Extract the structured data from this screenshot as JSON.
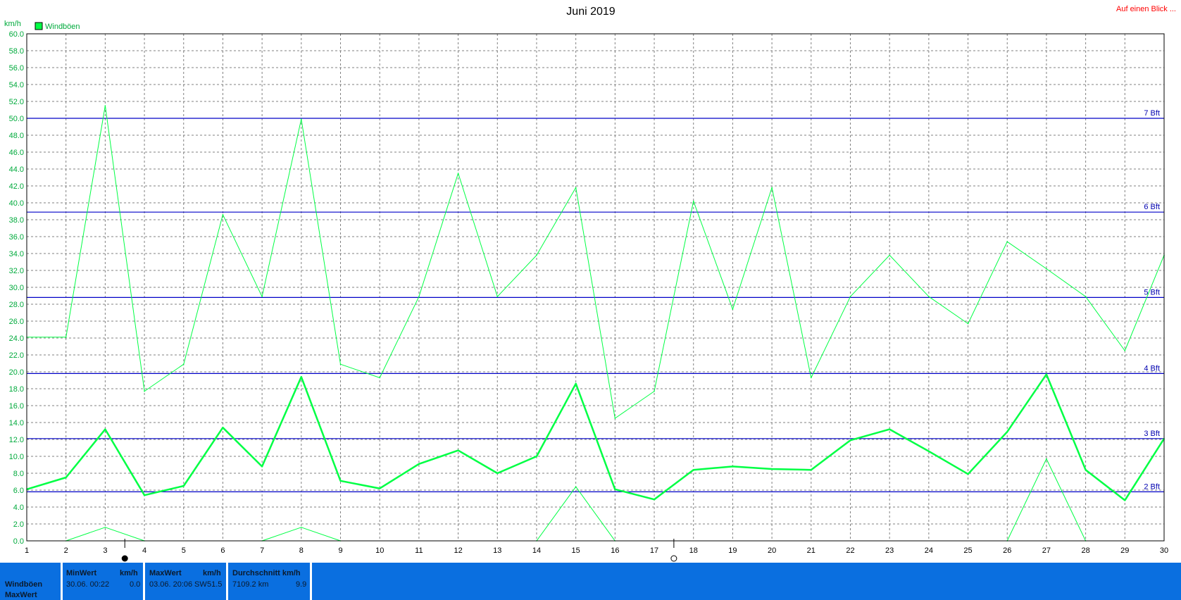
{
  "header": {
    "title": "Juni 2019",
    "link": "Auf einen Blick ...",
    "unit": "km/h",
    "legend": "Windböen"
  },
  "colors": {
    "series": "#00ff44",
    "grid": "#808080",
    "bft": "#0000c8",
    "link": "#ff0000",
    "stats_bg": "#0a6fe0"
  },
  "chart_data": {
    "type": "line",
    "title": "Juni 2019",
    "xlabel": "",
    "ylabel": "km/h",
    "xlim": [
      1,
      30
    ],
    "ylim": [
      0,
      60
    ],
    "x": [
      1,
      2,
      3,
      4,
      5,
      6,
      7,
      8,
      9,
      10,
      11,
      12,
      13,
      14,
      15,
      16,
      17,
      18,
      19,
      20,
      21,
      22,
      23,
      24,
      25,
      26,
      27,
      28,
      29,
      30
    ],
    "y_ticks": [
      "0.0",
      "2.0",
      "4.0",
      "6.0",
      "8.0",
      "10.0",
      "12.0",
      "14.0",
      "16.0",
      "18.0",
      "20.0",
      "22.0",
      "24.0",
      "26.0",
      "28.0",
      "30.0",
      "32.0",
      "34.0",
      "36.0",
      "38.0",
      "40.0",
      "42.0",
      "44.0",
      "46.0",
      "48.0",
      "50.0",
      "52.0",
      "54.0",
      "56.0",
      "58.0",
      "60.0"
    ],
    "x_ticks": [
      "1",
      "2",
      "3",
      "4",
      "5",
      "6",
      "7",
      "8",
      "9",
      "10",
      "11",
      "12",
      "13",
      "14",
      "15",
      "16",
      "17",
      "18",
      "19",
      "20",
      "21",
      "22",
      "23",
      "24",
      "25",
      "26",
      "27",
      "28",
      "29",
      "30"
    ],
    "grid": true,
    "legend_position": "top-left",
    "series": [
      {
        "name": "Windböen",
        "role": "max",
        "values": [
          24.1,
          24.1,
          51.5,
          17.7,
          20.9,
          38.6,
          28.9,
          49.9,
          20.9,
          19.3,
          28.9,
          43.5,
          28.9,
          33.8,
          41.8,
          14.5,
          17.7,
          40.2,
          27.4,
          41.8,
          19.3,
          28.9,
          33.8,
          28.9,
          25.7,
          35.4,
          32.2,
          28.9,
          22.5,
          33.8
        ]
      },
      {
        "name": "Windböen",
        "role": "avg",
        "values": [
          6.1,
          7.5,
          13.2,
          5.4,
          6.5,
          13.4,
          8.8,
          19.4,
          7.1,
          6.2,
          9.1,
          10.7,
          8.0,
          10.0,
          18.6,
          6.1,
          4.9,
          8.4,
          8.8,
          8.5,
          8.4,
          11.9,
          13.2,
          10.6,
          7.9,
          12.9,
          19.7,
          8.4,
          4.8,
          12.1
        ]
      },
      {
        "name": "Windböen",
        "role": "min",
        "values": [
          null,
          0.0,
          1.6,
          0.0,
          null,
          null,
          0.0,
          1.6,
          0.0,
          null,
          null,
          null,
          null,
          0.0,
          6.4,
          0.0,
          null,
          null,
          null,
          null,
          null,
          null,
          null,
          null,
          null,
          0.0,
          9.7,
          0.0,
          null,
          null
        ]
      }
    ],
    "reference_lines": [
      {
        "label": "2 Bft",
        "value": 5.8
      },
      {
        "label": "3 Bft",
        "value": 12.1
      },
      {
        "label": "4 Bft",
        "value": 19.8
      },
      {
        "label": "5 Bft",
        "value": 28.8
      },
      {
        "label": "6 Bft",
        "value": 38.9
      },
      {
        "label": "7 Bft",
        "value": 50.0
      }
    ],
    "markers": [
      {
        "symbol": "full-moon",
        "day": 3.5
      },
      {
        "symbol": "new-moon",
        "day": 17.5
      }
    ]
  },
  "stats": {
    "row_label": "Windböen",
    "row_label_2": "MaxWert",
    "min": {
      "header": "MinWert",
      "unit": "km/h",
      "date_time": "30.06.  00:22",
      "value": "0.0"
    },
    "max": {
      "header": "MaxWert",
      "unit": "km/h",
      "date_time": "03.06.  20:06",
      "direction": "SW",
      "value": "51.5"
    },
    "avg": {
      "header": "Durchschnitt km/h",
      "distance": "7109.2 km",
      "value": "9.9"
    }
  }
}
